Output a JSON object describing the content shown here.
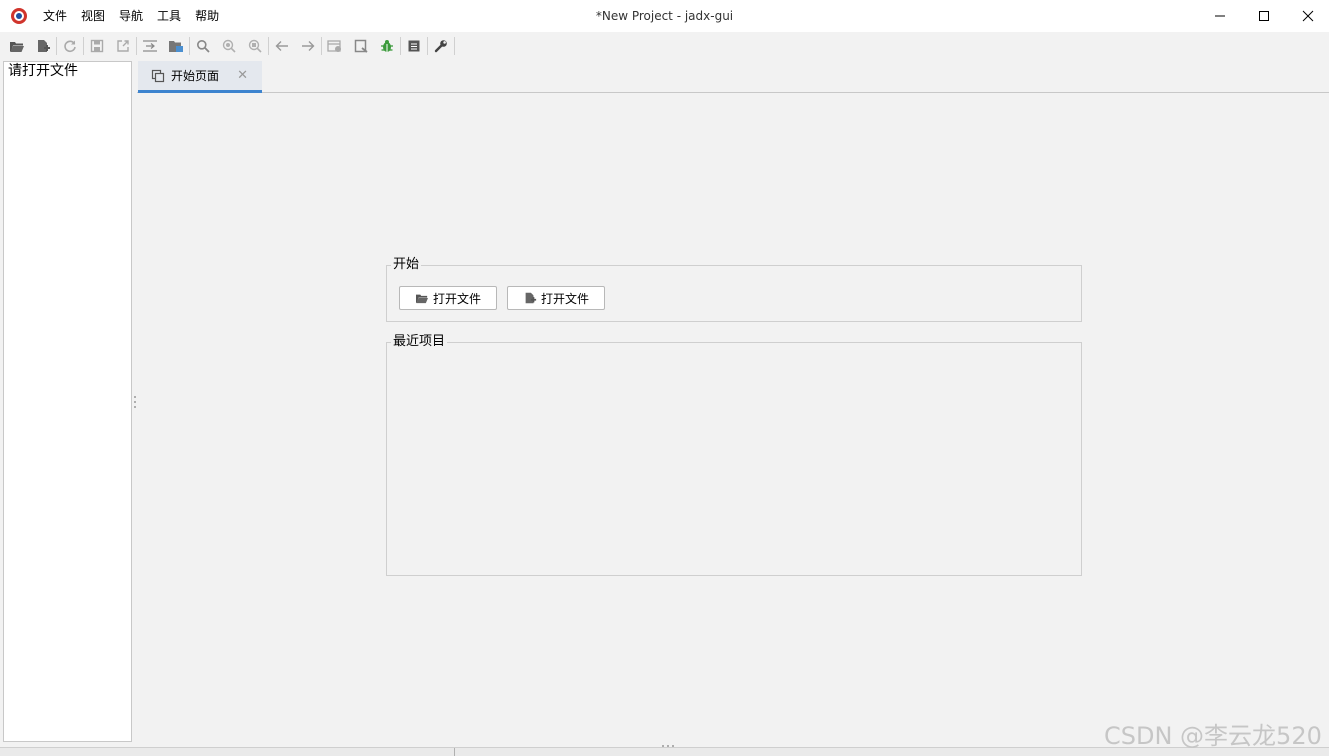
{
  "window": {
    "title": "*New Project - jadx-gui",
    "app_icon": "jadx-logo-icon",
    "controls": [
      "minimize-icon",
      "maximize-icon",
      "close-icon"
    ]
  },
  "menu": {
    "items": [
      {
        "label": "文件"
      },
      {
        "label": "视图"
      },
      {
        "label": "导航"
      },
      {
        "label": "工具"
      },
      {
        "label": "帮助"
      }
    ]
  },
  "toolbar": {
    "buttons": [
      "open-folder-icon",
      "add-files-icon",
      "reload-icon",
      "save-icon",
      "export-icon",
      "sync-tree-icon",
      "flatten-packages-icon",
      "search-icon",
      "find-class-icon",
      "find-usage-icon",
      "back-icon",
      "forward-icon",
      "decompile-all-icon",
      "quark-icon",
      "debugger-icon",
      "log-icon",
      "settings-wrench-icon"
    ]
  },
  "left_panel": {
    "hint": "请打开文件"
  },
  "tabs": [
    {
      "label": "开始页面",
      "icon": "start-page-icon",
      "active": true
    }
  ],
  "start_page": {
    "start_group_title": "开始",
    "open_file_button": "打开文件",
    "open_project_button": "打开文件",
    "recent_group_title": "最近项目",
    "recent_items": []
  },
  "watermark": "CSDN @李云龙520",
  "colors": {
    "tab_accent": "#3d84cf",
    "background": "#f2f2f2",
    "debugger_green": "#3c9a3c",
    "logo_red": "#d0342c"
  }
}
